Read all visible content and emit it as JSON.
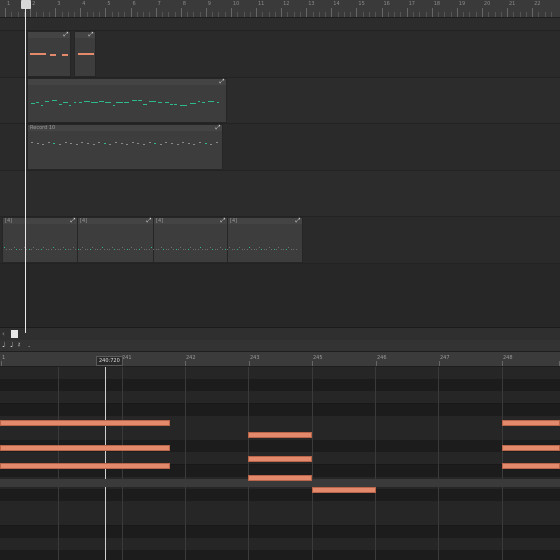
{
  "colors": {
    "accent_orange": "#e28a6b",
    "midi_green": "#2db98b",
    "bg_dark": "#202020",
    "panel": "#2a2a2a"
  },
  "ruler": {
    "labels": [
      "1",
      "2",
      "3",
      "4",
      "5",
      "6",
      "7",
      "8",
      "9",
      "10",
      "11",
      "12",
      "13",
      "14",
      "15",
      "16",
      "17",
      "18",
      "19",
      "20",
      "21",
      "22"
    ]
  },
  "clips": {
    "recordclip_label": "Record 10",
    "audio_labels": [
      "[4]",
      "[4]",
      "[4]",
      "[4]"
    ],
    "clip_menu_icon": "arrow-icon"
  },
  "editor": {
    "tools": [
      "♩",
      "♩",
      "𝄽",
      "."
    ],
    "position_readout": "240:720",
    "ruler_labels": [
      "1",
      "289",
      "241",
      "242",
      "243",
      "245",
      "246",
      "247",
      "248",
      "249"
    ]
  },
  "icons": {
    "playhead": "playhead-marker-icon",
    "scroll": "scroll-thumb"
  }
}
